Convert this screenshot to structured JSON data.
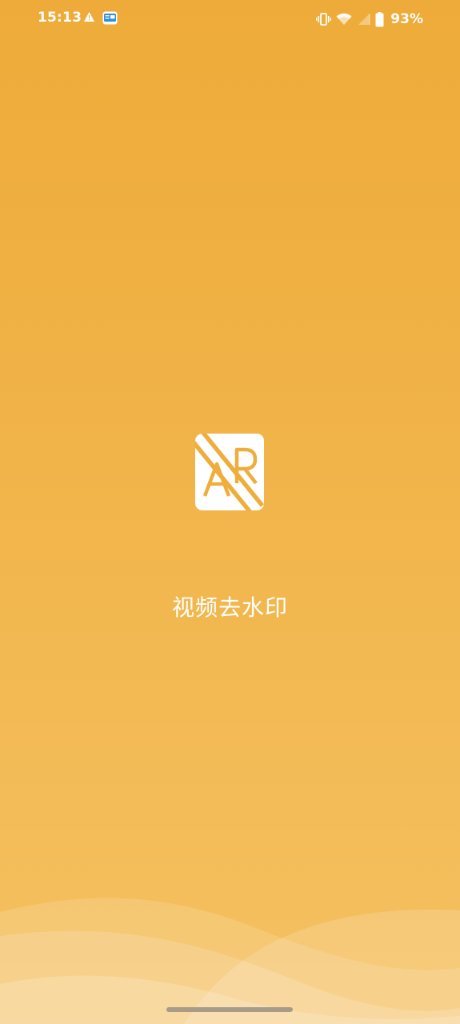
{
  "status_bar": {
    "time": "15:13",
    "battery_percent": "93%",
    "battery_level": 0.93,
    "notification_icons": [
      "warning-icon",
      "app-badge-icon"
    ],
    "system_icons": [
      "vibrate-icon",
      "wifi-icon",
      "signal-icon",
      "battery-icon"
    ]
  },
  "splash": {
    "logo_icon": "watermark-remove-logo-icon",
    "logo_letters": "AR",
    "app_name": "视频去水印"
  },
  "colors": {
    "background_top": "#eeab39",
    "background_bottom": "#f5c162",
    "text": "#ffffff"
  }
}
